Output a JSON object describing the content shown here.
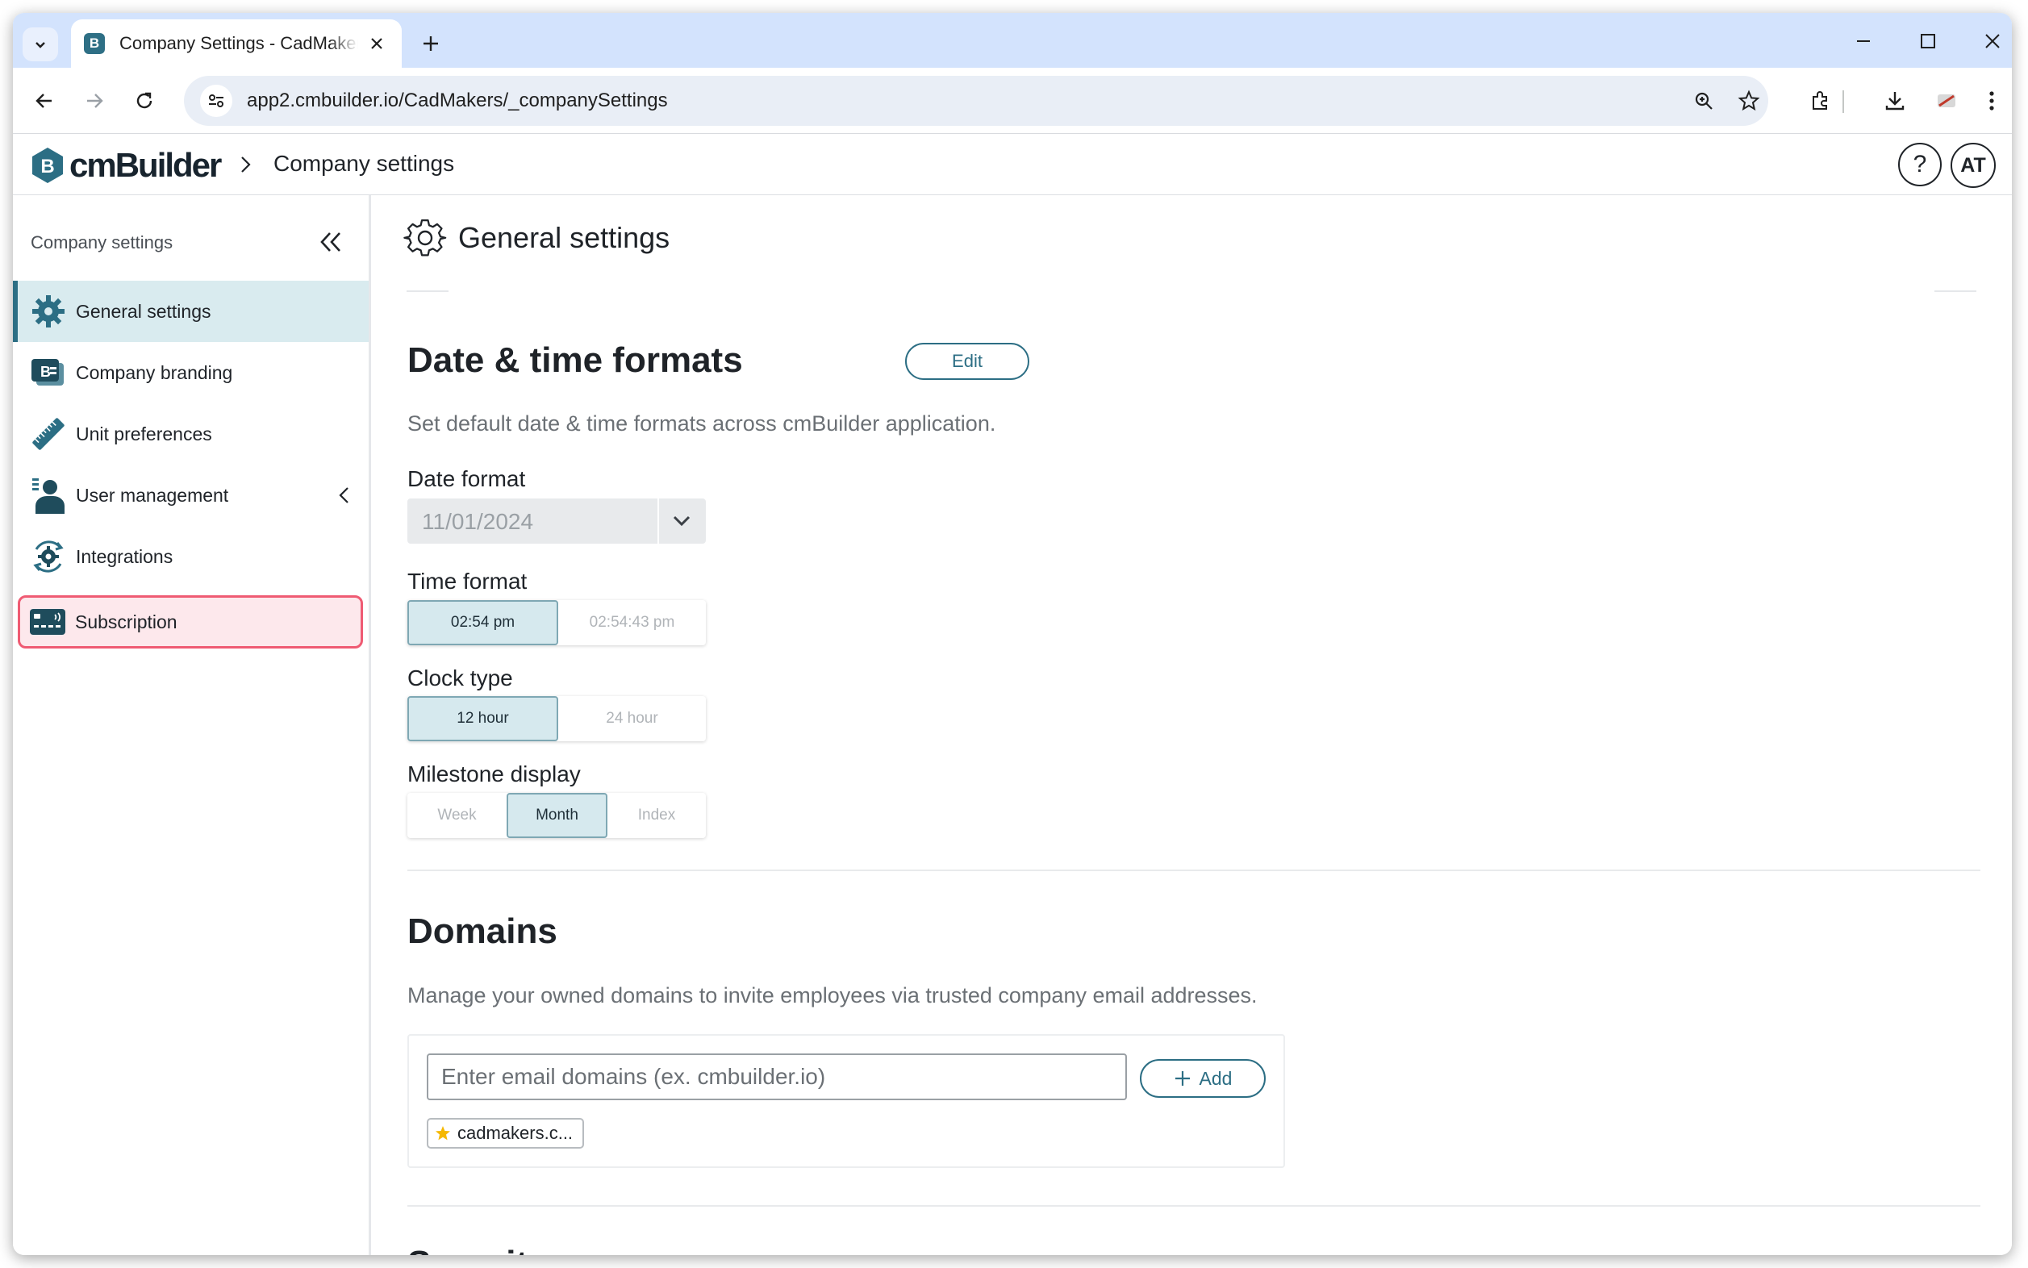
{
  "browser": {
    "tab_title": "Company Settings - CadMakers",
    "url": "app2.cmbuilder.io/CadMakers/_companySettings",
    "icons": [
      "tab-search-icon",
      "close-icon",
      "plus-icon",
      "minimize-icon",
      "maximize-icon",
      "close-window-icon",
      "back-icon",
      "forward-icon",
      "reload-icon",
      "site-info-icon",
      "zoom-icon",
      "star-icon",
      "extensions-icon",
      "download-icon",
      "profile-icon",
      "menu-icon"
    ]
  },
  "header": {
    "logo_text": "cmBuilder",
    "breadcrumb": "Company settings",
    "help_label": "?",
    "avatar_initials": "AT"
  },
  "sidebar": {
    "title": "Company settings",
    "items": [
      {
        "label": "General settings",
        "icon": "gear-icon",
        "active": true
      },
      {
        "label": "Company branding",
        "icon": "branding-icon"
      },
      {
        "label": "Unit preferences",
        "icon": "ruler-icon"
      },
      {
        "label": "User management",
        "icon": "user-icon",
        "expandable": true
      },
      {
        "label": "Integrations",
        "icon": "integrations-icon"
      },
      {
        "label": "Subscription",
        "icon": "card-icon",
        "highlighted": true
      }
    ]
  },
  "main": {
    "page_title": "General settings",
    "date_time": {
      "title": "Date & time formats",
      "edit_label": "Edit",
      "description": "Set default date & time formats across cmBuilder application.",
      "date_format_label": "Date format",
      "date_format_value": "11/01/2024",
      "time_format_label": "Time format",
      "time_options": [
        "02:54 pm",
        "02:54:43 pm"
      ],
      "time_selected": "02:54 pm",
      "clock_type_label": "Clock type",
      "clock_options": [
        "12 hour",
        "24 hour"
      ],
      "clock_selected": "12 hour",
      "milestone_label": "Milestone display",
      "milestone_options": [
        "Week",
        "Month",
        "Index"
      ],
      "milestone_selected": "Month"
    },
    "domains": {
      "title": "Domains",
      "description": "Manage your owned domains to invite employees via trusted company email addresses.",
      "input_placeholder": "Enter email domains (ex. cmbuilder.io)",
      "add_label": "Add",
      "chips": [
        "cadmakers.c..."
      ]
    },
    "next_section_title": "Security"
  },
  "colors": {
    "accent": "#2c6e84",
    "active_bg": "#d9ebef",
    "highlight_border": "#ef5b73",
    "chrome_tabstrip": "#d3e3fd"
  }
}
